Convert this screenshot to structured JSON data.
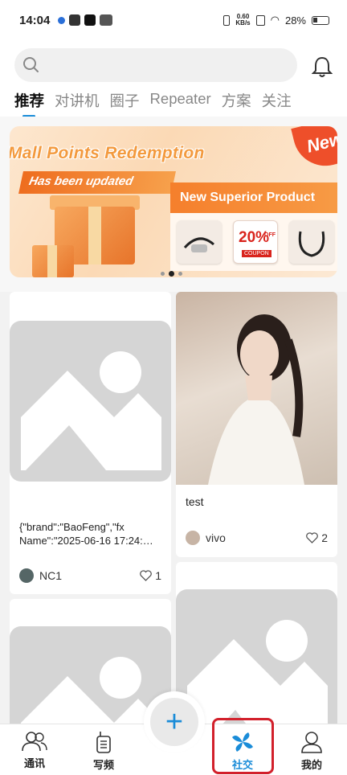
{
  "status_bar": {
    "time": "14:04",
    "speed_value": "0.60",
    "speed_unit": "KB/s",
    "battery": "28%"
  },
  "search": {
    "placeholder": ""
  },
  "tabs": [
    {
      "label": "推荐",
      "active": true
    },
    {
      "label": "对讲机"
    },
    {
      "label": "圈子"
    },
    {
      "label": "Repeater"
    },
    {
      "label": "方案"
    },
    {
      "label": "关注"
    }
  ],
  "banner": {
    "title": "Mall Points Redemption",
    "subtitle": "Has been updated",
    "badge": "New",
    "product_header": "New Superior Product",
    "coupon_percent": "20%",
    "coupon_off": "OFF",
    "coupon_label": "COUPON",
    "slide_count": 3,
    "active_slide": 1
  },
  "feed": [
    {
      "text_line1": "{\"brand\":\"BaoFeng\",\"fx",
      "text_line2": "Name\":\"2025-06-16 17:24:…",
      "user": "NC1",
      "likes": "1",
      "image": "placeholder"
    },
    {
      "text_line1": "test",
      "user": "vivo",
      "likes": "2",
      "image": "photo"
    },
    {
      "image": "placeholder"
    },
    {
      "image": "placeholder"
    }
  ],
  "bottom_nav": [
    {
      "label": "通讯",
      "icon": "contacts-icon"
    },
    {
      "label": "写频",
      "icon": "walkie-talkie-icon"
    },
    {
      "label": "+",
      "icon": "add-icon"
    },
    {
      "label": "社交",
      "icon": "pinwheel-icon",
      "active": true
    },
    {
      "label": "我的",
      "icon": "profile-icon"
    }
  ],
  "colors": {
    "accent": "#1a8cd8",
    "highlight": "#d2202b",
    "placeholder": "#d5d5d5"
  }
}
